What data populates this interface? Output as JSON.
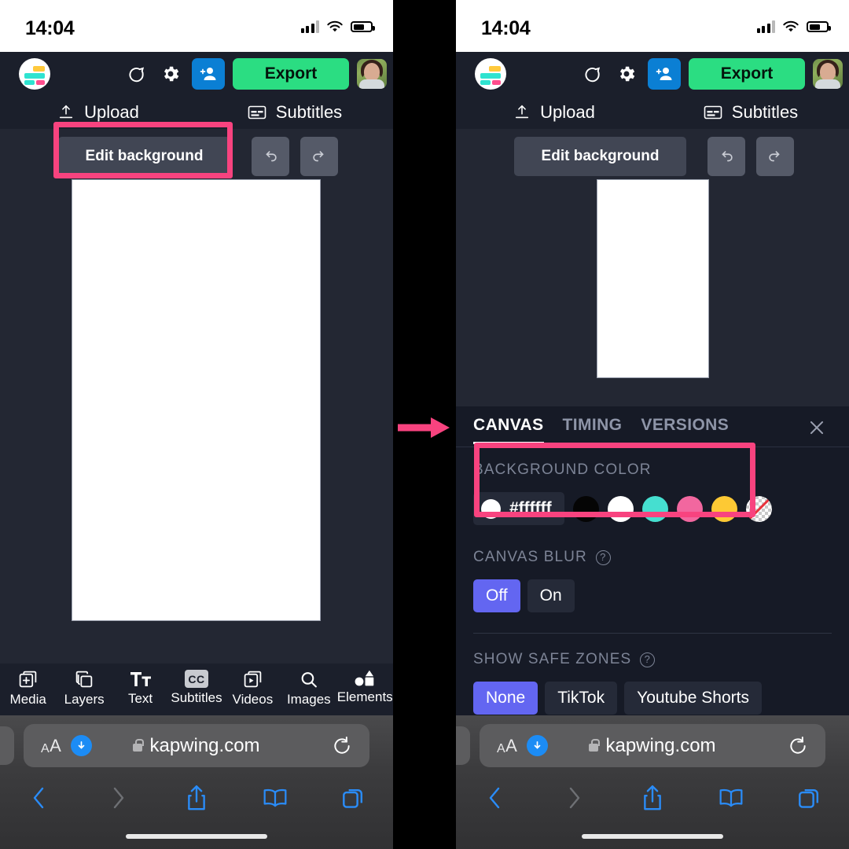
{
  "meta": {
    "accent_pink": "#f8437f",
    "app_bg": "#232733",
    "app_header_bg": "#1b1f2b",
    "panel_bg": "#161a26",
    "select_purple": "#6366f1",
    "export_green": "#2bdd82",
    "invite_blue": "#0b7fd4"
  },
  "status_bar": {
    "time": "14:04",
    "signal_icon": "cellular-signal-icon",
    "wifi_icon": "wifi-icon",
    "battery_icon": "battery-icon"
  },
  "app_header": {
    "logo_icon": "kapwing-logo-icon",
    "comment_icon": "comment-bubble-icon",
    "settings_icon": "gear-icon",
    "invite_icon": "add-person-icon",
    "export_label": "Export",
    "avatar_icon": "user-avatar"
  },
  "tabstrip": {
    "tabs": [
      {
        "label": "Upload",
        "icon": "upload-icon"
      },
      {
        "label": "Subtitles",
        "icon": "subtitles-icon"
      }
    ]
  },
  "editor_bar": {
    "edit_background_label": "Edit background",
    "undo_icon": "undo-arrow-icon",
    "redo_icon": "redo-arrow-icon"
  },
  "dock": {
    "items": [
      {
        "label": "Media",
        "icon": "media-add-icon"
      },
      {
        "label": "Layers",
        "icon": "layers-icon"
      },
      {
        "label": "Text",
        "icon": "text-tt-icon"
      },
      {
        "label": "Subtitles",
        "icon": "cc-icon"
      },
      {
        "label": "Videos",
        "icon": "video-stack-icon"
      },
      {
        "label": "Images",
        "icon": "search-icon"
      },
      {
        "label": "Elements",
        "icon": "shapes-icon"
      }
    ]
  },
  "properties_panel": {
    "tabs": [
      {
        "label": "CANVAS",
        "active": true
      },
      {
        "label": "TIMING",
        "active": false
      },
      {
        "label": "VERSIONS",
        "active": false
      }
    ],
    "close_icon": "close-icon",
    "background_color": {
      "section_label": "BACKGROUND COLOR",
      "hex_value": "#ffffff",
      "current_dot_color": "#ffffff",
      "swatches": [
        {
          "name": "black",
          "color": "#050505"
        },
        {
          "name": "white",
          "color": "#ffffff"
        },
        {
          "name": "teal",
          "color": "#45dfd0"
        },
        {
          "name": "pink",
          "color": "#f2679f"
        },
        {
          "name": "yellow",
          "color": "#fdc934"
        },
        {
          "name": "transparent",
          "color": "transparent"
        }
      ]
    },
    "canvas_blur": {
      "section_label": "CANVAS BLUR",
      "help_icon": "help-circle-icon",
      "options": [
        {
          "label": "Off",
          "selected": true
        },
        {
          "label": "On",
          "selected": false
        }
      ]
    },
    "show_safe_zones": {
      "section_label": "SHOW SAFE ZONES",
      "help_icon": "help-circle-icon",
      "options": [
        {
          "label": "None",
          "selected": true
        },
        {
          "label": "TikTok",
          "selected": false
        },
        {
          "label": "Youtube Shorts",
          "selected": false
        }
      ],
      "options_row2": [
        {
          "label": "",
          "selected": false
        },
        {
          "label": "",
          "selected": false
        }
      ]
    }
  },
  "safari": {
    "aa_label_small": "A",
    "aa_label_large": "A",
    "download_icon": "download-arrow-icon",
    "lock_icon": "lock-icon",
    "url": "kapwing.com",
    "reload_icon": "reload-icon",
    "nav": [
      {
        "name": "back-button",
        "icon": "chevron-left-icon"
      },
      {
        "name": "forward-button",
        "icon": "chevron-right-icon"
      },
      {
        "name": "share-button",
        "icon": "share-icon"
      },
      {
        "name": "bookmarks-button",
        "icon": "book-icon"
      },
      {
        "name": "tabs-button",
        "icon": "tabs-icon"
      }
    ]
  },
  "annotations": {
    "arrow_icon": "right-arrow-annotation",
    "highlight_edit_background": "highlight-box-edit-background",
    "highlight_background_color": "highlight-box-background-color"
  }
}
